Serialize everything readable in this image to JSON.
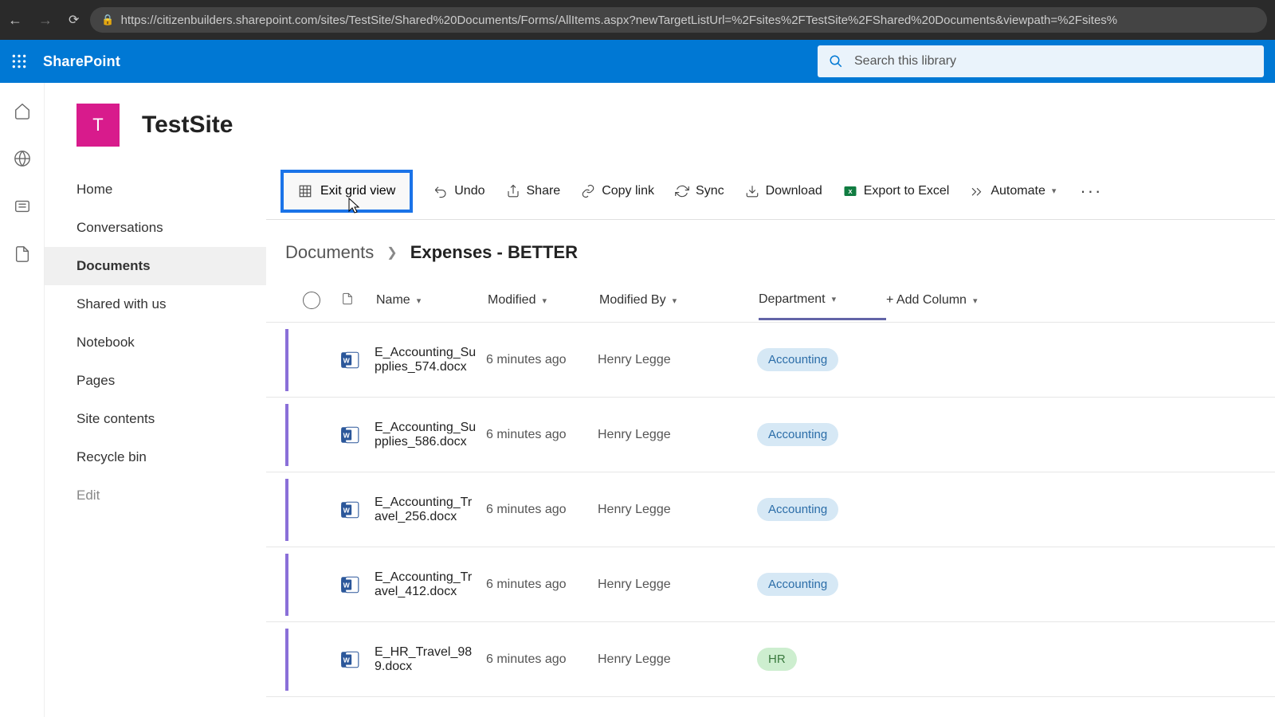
{
  "browser": {
    "url": "https://citizenbuilders.sharepoint.com/sites/TestSite/Shared%20Documents/Forms/AllItems.aspx?newTargetListUrl=%2Fsites%2FTestSite%2FShared%20Documents&viewpath=%2Fsites%"
  },
  "suite": {
    "app_name": "SharePoint",
    "search_placeholder": "Search this library"
  },
  "site": {
    "avatar_letter": "T",
    "title": "TestSite"
  },
  "quick_launch": [
    {
      "label": "Home",
      "selected": false
    },
    {
      "label": "Conversations",
      "selected": false
    },
    {
      "label": "Documents",
      "selected": true
    },
    {
      "label": "Shared with us",
      "selected": false
    },
    {
      "label": "Notebook",
      "selected": false
    },
    {
      "label": "Pages",
      "selected": false
    },
    {
      "label": "Site contents",
      "selected": false
    },
    {
      "label": "Recycle bin",
      "selected": false
    }
  ],
  "quick_launch_edit": "Edit",
  "commands": {
    "exit_grid": "Exit grid view",
    "undo": "Undo",
    "share": "Share",
    "copy_link": "Copy link",
    "sync": "Sync",
    "download": "Download",
    "export_excel": "Export to Excel",
    "automate": "Automate"
  },
  "breadcrumb": {
    "root": "Documents",
    "current": "Expenses - BETTER"
  },
  "columns": {
    "name": "Name",
    "modified": "Modified",
    "modified_by": "Modified By",
    "department": "Department",
    "add": "+ Add Column"
  },
  "rows": [
    {
      "name": "E_Accounting_Supplies_574.docx",
      "modified": "6 minutes ago",
      "modified_by": "Henry Legge",
      "department": "Accounting",
      "dept_style": "accounting"
    },
    {
      "name": "E_Accounting_Supplies_586.docx",
      "modified": "6 minutes ago",
      "modified_by": "Henry Legge",
      "department": "Accounting",
      "dept_style": "accounting"
    },
    {
      "name": "E_Accounting_Travel_256.docx",
      "modified": "6 minutes ago",
      "modified_by": "Henry Legge",
      "department": "Accounting",
      "dept_style": "accounting"
    },
    {
      "name": "E_Accounting_Travel_412.docx",
      "modified": "6 minutes ago",
      "modified_by": "Henry Legge",
      "department": "Accounting",
      "dept_style": "accounting"
    },
    {
      "name": "E_HR_Travel_989.docx",
      "modified": "6 minutes ago",
      "modified_by": "Henry Legge",
      "department": "HR",
      "dept_style": "hr"
    }
  ]
}
